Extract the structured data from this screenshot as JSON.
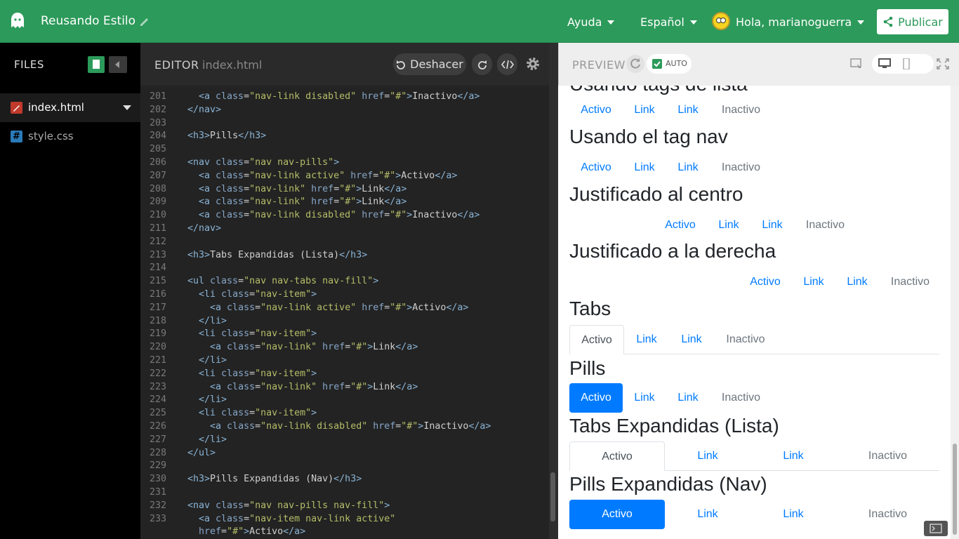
{
  "topbar": {
    "project_title": "Reusando Estilo",
    "help": "Ayuda",
    "language": "Español",
    "greeting": "Hola, marianoguerra",
    "publish": "Publicar"
  },
  "files": {
    "title": "FILES",
    "items": [
      {
        "label": "index.html",
        "icon": "html-file-icon",
        "color": "#c0392b"
      },
      {
        "label": "style.css",
        "icon": "css-file-icon",
        "color": "#2b7bb9"
      }
    ]
  },
  "editor": {
    "title": "EDITOR",
    "file": "index.html",
    "undo": "Deshacer",
    "lines": [
      {
        "n": "201",
        "code": "  <a class=\"nav-link disabled\" href=\"#\">Inactivo</a>"
      },
      {
        "n": "202",
        "code": "</nav>"
      },
      {
        "n": "203",
        "code": ""
      },
      {
        "n": "204",
        "code": "<h3>Pills</h3>"
      },
      {
        "n": "205",
        "code": ""
      },
      {
        "n": "206",
        "code": "<nav class=\"nav nav-pills\">"
      },
      {
        "n": "207",
        "code": "  <a class=\"nav-link active\" href=\"#\">Activo</a>"
      },
      {
        "n": "208",
        "code": "  <a class=\"nav-link\" href=\"#\">Link</a>"
      },
      {
        "n": "209",
        "code": "  <a class=\"nav-link\" href=\"#\">Link</a>"
      },
      {
        "n": "210",
        "code": "  <a class=\"nav-link disabled\" href=\"#\">Inactivo</a>"
      },
      {
        "n": "211",
        "code": "</nav>"
      },
      {
        "n": "212",
        "code": ""
      },
      {
        "n": "213",
        "code": "<h3>Tabs Expandidas (Lista)</h3>"
      },
      {
        "n": "214",
        "code": ""
      },
      {
        "n": "215",
        "code": "<ul class=\"nav nav-tabs nav-fill\">"
      },
      {
        "n": "216",
        "code": "  <li class=\"nav-item\">"
      },
      {
        "n": "217",
        "code": "    <a class=\"nav-link active\" href=\"#\">Activo</a>"
      },
      {
        "n": "218",
        "code": "  </li>"
      },
      {
        "n": "219",
        "code": "  <li class=\"nav-item\">"
      },
      {
        "n": "220",
        "code": "    <a class=\"nav-link\" href=\"#\">Link</a>"
      },
      {
        "n": "221",
        "code": "  </li>"
      },
      {
        "n": "222",
        "code": "  <li class=\"nav-item\">"
      },
      {
        "n": "223",
        "code": "    <a class=\"nav-link\" href=\"#\">Link</a>"
      },
      {
        "n": "224",
        "code": "  </li>"
      },
      {
        "n": "225",
        "code": "  <li class=\"nav-item\">"
      },
      {
        "n": "226",
        "code": "    <a class=\"nav-link disabled\" href=\"#\">Inactivo</a>"
      },
      {
        "n": "227",
        "code": "  </li>"
      },
      {
        "n": "228",
        "code": "</ul>"
      },
      {
        "n": "229",
        "code": ""
      },
      {
        "n": "230",
        "code": "<h3>Pills Expandidas (Nav)</h3>"
      },
      {
        "n": "231",
        "code": ""
      },
      {
        "n": "232",
        "code": "<nav class=\"nav nav-pills nav-fill\">"
      },
      {
        "n": "233",
        "code": "  <a class=\"nav-item nav-link active\""
      },
      {
        "n": "",
        "code": "  href=\"#\">Activo</a>"
      }
    ]
  },
  "preview": {
    "title": "PREVIEW",
    "auto": "AUTO",
    "sections": [
      {
        "heading": "Usando tags de lista",
        "style": "plain-left",
        "links": [
          "Activo",
          "Link",
          "Link",
          "Inactivo"
        ]
      },
      {
        "heading": "Usando el tag nav",
        "style": "plain-left",
        "links": [
          "Activo",
          "Link",
          "Link",
          "Inactivo"
        ]
      },
      {
        "heading": "Justificado al centro",
        "style": "plain-center",
        "links": [
          "Activo",
          "Link",
          "Link",
          "Inactivo"
        ]
      },
      {
        "heading": "Justificado a la derecha",
        "style": "plain-right",
        "links": [
          "Activo",
          "Link",
          "Link",
          "Inactivo"
        ]
      },
      {
        "heading": "Tabs",
        "style": "tabs",
        "links": [
          "Activo",
          "Link",
          "Link",
          "Inactivo"
        ]
      },
      {
        "heading": "Pills",
        "style": "pills",
        "links": [
          "Activo",
          "Link",
          "Link",
          "Inactivo"
        ]
      },
      {
        "heading": "Tabs Expandidas (Lista)",
        "style": "tabs-fill",
        "links": [
          "Activo",
          "Link",
          "Link",
          "Inactivo"
        ]
      },
      {
        "heading": "Pills Expandidas (Nav)",
        "style": "pills-fill",
        "links": [
          "Activo",
          "Link",
          "Link",
          "Inactivo"
        ]
      }
    ]
  },
  "colors": {
    "brand_green": "#2c9a5a",
    "link_blue": "#007bff",
    "disabled_gray": "#6c757d"
  }
}
